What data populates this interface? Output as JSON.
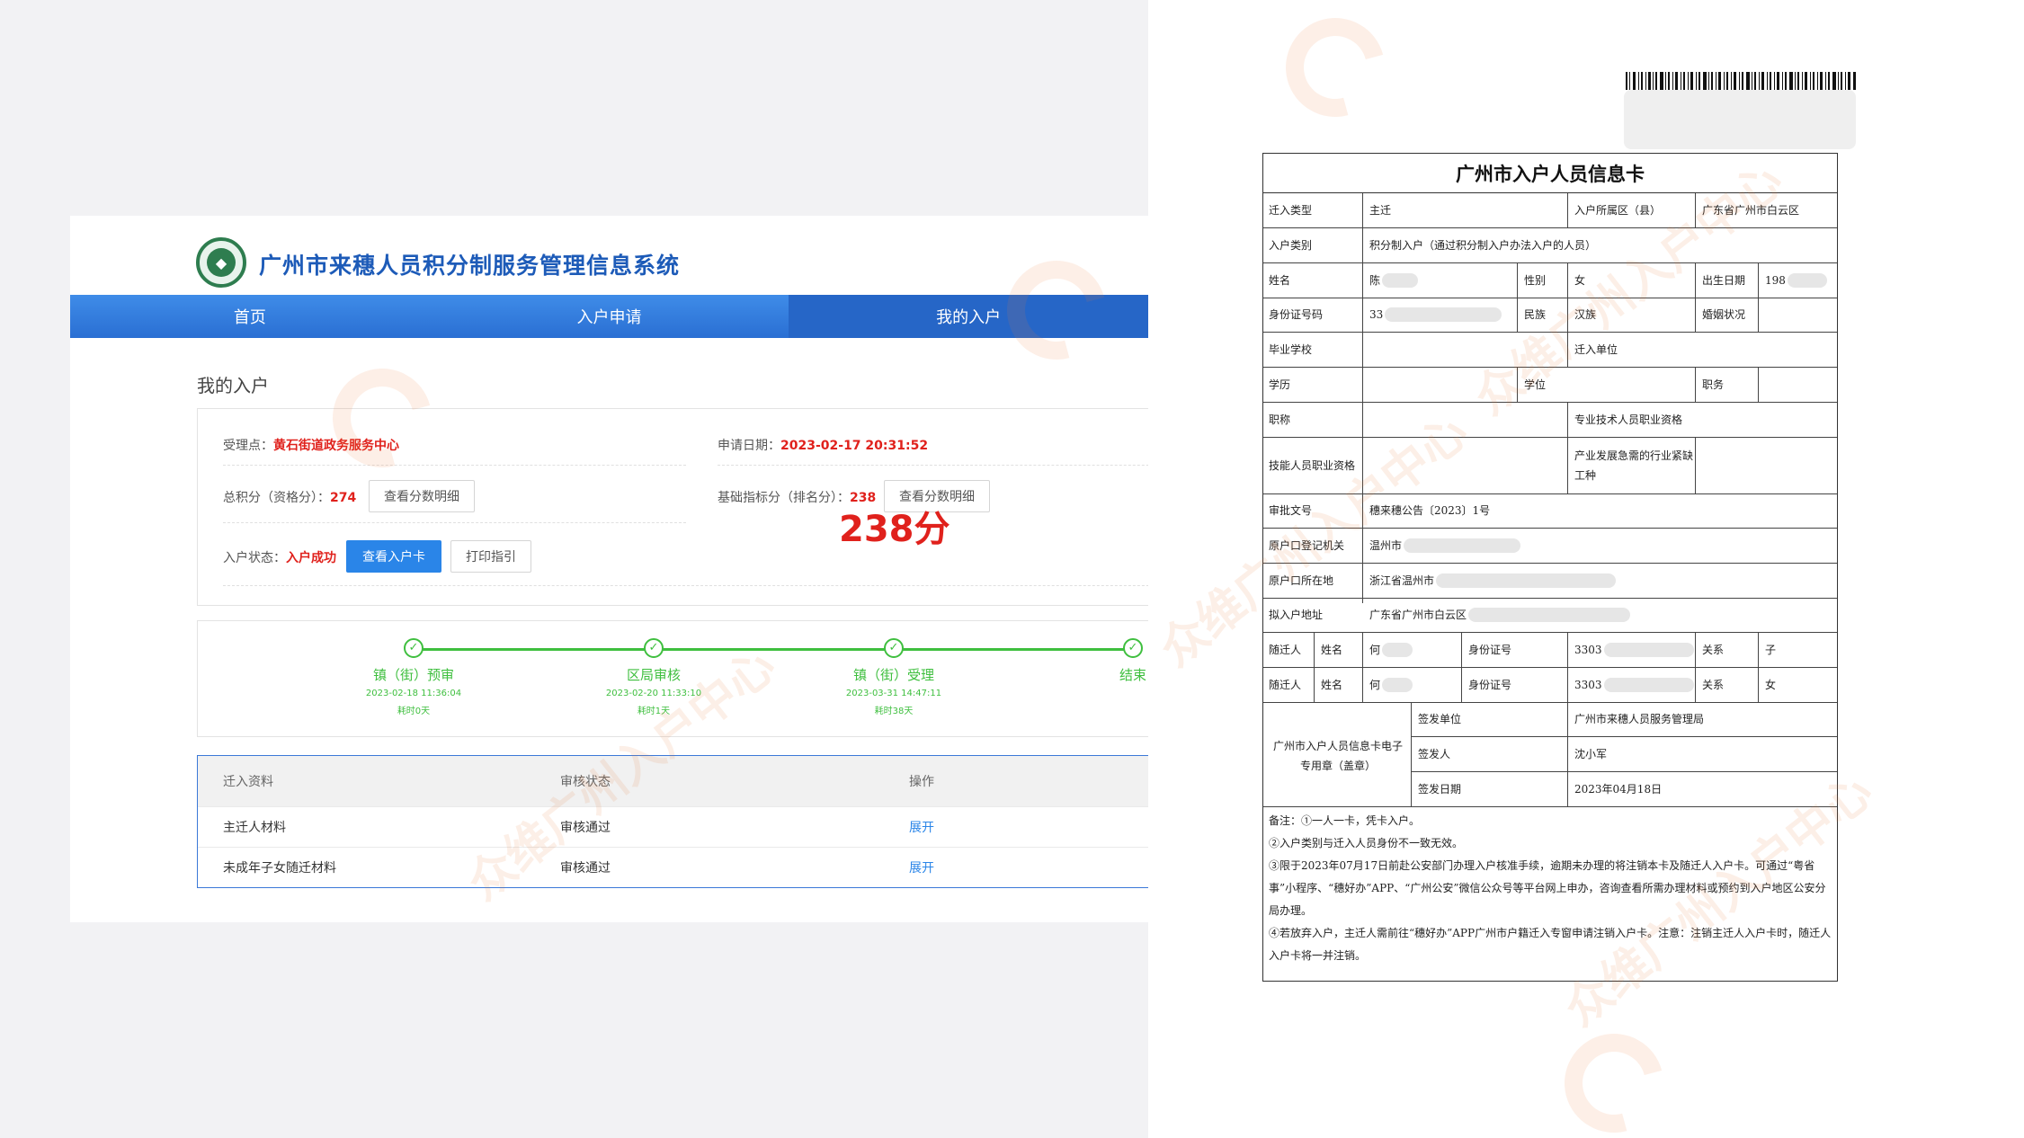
{
  "system": {
    "title": "广州市来穗人员积分制服务管理信息系统",
    "nav": [
      "首页",
      "入户申请",
      "我的入户"
    ]
  },
  "my_entry": {
    "section_title": "我的入户",
    "accept_label": "受理点：",
    "accept_value": "黄石街道政务服务中心",
    "apply_date_label": "申请日期：",
    "apply_date_value": "2023-02-17 20:31:52",
    "total_score_label": "总积分（资格分）：",
    "total_score_value": "274",
    "view_score_btn": "查看分数明细",
    "base_score_label": "基础指标分（排名分）：",
    "base_score_value": "238",
    "view_score_btn2": "查看分数明细",
    "big_score": "238分",
    "status_label": "入户状态：",
    "status_value": "入户成功",
    "view_card_btn": "查看入户卡",
    "print_btn": "打印指引"
  },
  "progress": [
    {
      "name": "镇（街）预审",
      "time": "2023-02-18 11:36:04",
      "duration": "耗时0天"
    },
    {
      "name": "区局审核",
      "time": "2023-02-20 11:33:10",
      "duration": "耗时1天"
    },
    {
      "name": "镇（街）受理",
      "time": "2023-03-31 14:47:11",
      "duration": "耗时38天"
    },
    {
      "name": "结束",
      "time": "",
      "duration": ""
    }
  ],
  "materials": {
    "headers": [
      "迁入资料",
      "审核状态",
      "操作"
    ],
    "rows": [
      {
        "name": "主迁人材料",
        "status": "审核通过",
        "action": "展开"
      },
      {
        "name": "未成年子女随迁材料",
        "status": "审核通过",
        "action": "展开"
      }
    ]
  },
  "card": {
    "title": "广州市入户人员信息卡",
    "move_type_label": "迁入类型",
    "move_type": "主迁",
    "district_label": "入户所属区（县）",
    "district": "广东省广州市白云区",
    "category_label": "入户类别",
    "category": "积分制入户（通过积分制入户办法入户的人员）",
    "name_label": "姓名",
    "name": "陈",
    "gender_label": "性别",
    "gender": "女",
    "birth_label": "出生日期",
    "birth": "198",
    "id_label": "身份证号码",
    "id": "33",
    "ethnic_label": "民族",
    "ethnic": "汉族",
    "marriage_label": "婚姻状况",
    "school_label": "毕业学校",
    "unit_label": "迁入单位",
    "education_label": "学历",
    "degree_label": "学位",
    "duty_label": "职务",
    "title_label": "职称",
    "pro_qual_label": "专业技术人员职业资格",
    "skill_label": "技能人员职业资格",
    "industry_label": "产业发展急需的行业紧缺工种",
    "approval_label": "审批文号",
    "approval": "穗来穗公告〔2023〕1号",
    "reg_org_label": "原户口登记机关",
    "reg_org": "温州市",
    "orig_addr_label": "原户口所在地",
    "orig_addr": "浙江省温州市",
    "new_addr_label": "拟入户地址",
    "new_addr": "广东省广州市白云区",
    "companion_label": "随迁人",
    "companion_name_label": "姓名",
    "companion_id_label": "身份证号",
    "companion_rel_label": "关系",
    "companions": [
      {
        "name": "何",
        "id": "3303",
        "relation": "子"
      },
      {
        "name": "何",
        "id": "3303",
        "relation": "女"
      }
    ],
    "seal_text": "广州市入户人员信息卡电子专用章（盖章）",
    "issuer_label": "签发单位",
    "issuer": "广州市来穗人员服务管理局",
    "signer_label": "签发人",
    "signer": "沈小军",
    "issue_date_label": "签发日期",
    "issue_date": "2023年04月18日",
    "notes": [
      "备注：①一人一卡，凭卡入户。",
      "②入户类别与迁入人员身份不一致无效。",
      "③限于2023年07月17日前赴公安部门办理入户核准手续，逾期未办理的将注销本卡及随迁人入户卡。可通过“粤省事”小程序、“穗好办”APP、“广州公安”微信公众号等平台网上申办，咨询查看所需办理材料或预约到入户地区公安分局办理。",
      "④若放弃入户，主迁人需前往“穗好办”APP广州市户籍迁入专窗申请注销入户卡。注意：注销主迁人入户卡时，随迁人入户卡将一并注销。"
    ]
  },
  "watermark": "众维广州入户中心",
  "colors": {
    "accent": "#2a85e8",
    "red": "#e0211c",
    "green": "#3fbf3f",
    "nav": "#3b82e0"
  }
}
